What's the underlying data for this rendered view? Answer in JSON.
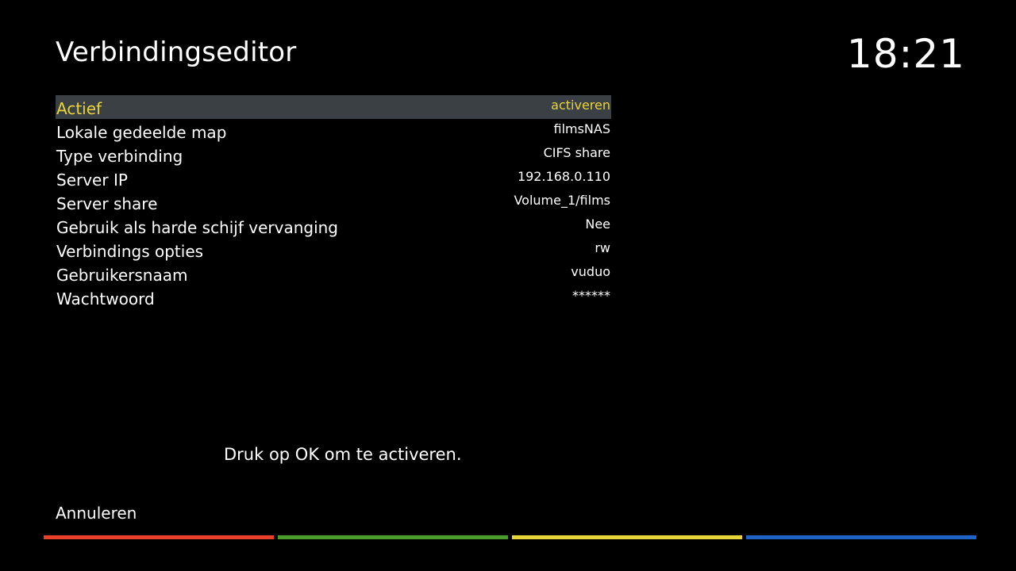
{
  "header": {
    "title": "Verbindingseditor",
    "clock": "18:21"
  },
  "config": {
    "rows": [
      {
        "label": "Actief",
        "value": "activeren"
      },
      {
        "label": "Lokale gedeelde map",
        "value": "filmsNAS"
      },
      {
        "label": "Type verbinding",
        "value": "CIFS share"
      },
      {
        "label": "Server IP",
        "value": "192.168.0.110"
      },
      {
        "label": "Server share",
        "value": "Volume_1/films"
      },
      {
        "label": "Gebruik als harde schijf vervanging",
        "value": "Nee"
      },
      {
        "label": "Verbindings opties",
        "value": "rw"
      },
      {
        "label": "Gebruikersnaam",
        "value": "vuduo"
      },
      {
        "label": "Wachtwoord",
        "value": "******"
      }
    ],
    "selected_index": 0
  },
  "help": {
    "text": "Druk op OK om te activeren."
  },
  "footer": {
    "cancel_label": "Annuleren"
  },
  "colors": {
    "background": "#000000",
    "highlight": "#3b4044",
    "selected_text": "#e8d53a",
    "red": "#e8402a",
    "green": "#4a9a2c",
    "yellow": "#e8d53a",
    "blue": "#1f63c4"
  }
}
